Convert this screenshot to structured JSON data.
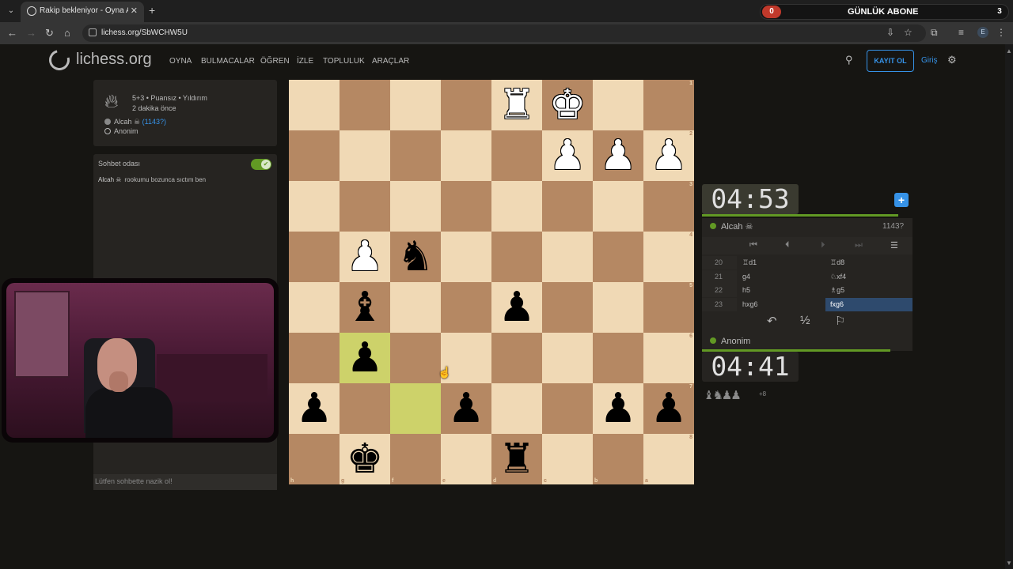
{
  "browser": {
    "tab_title": "Rakip bekleniyor - Oyna Alcah",
    "url": "lichess.org/SbWCHW5U",
    "sub_banner": {
      "left_count": "0",
      "title": "GÜNLÜK ABONE",
      "right_count": "3"
    }
  },
  "header": {
    "logo": "lichess.org",
    "nav": [
      "OYNA",
      "BULMACALAR",
      "ÖĞREN",
      "İZLE",
      "TOPLULUK",
      "ARAÇLAR"
    ],
    "signup": "KAYIT OL",
    "login": "Giriş"
  },
  "game_info": {
    "type": "5+3 • Puansız • Yıldırım",
    "time": "2 dakika önce",
    "player1_name": "Alcah ☠",
    "player1_rating": "(1143?)",
    "player2_name": "Anonim"
  },
  "chat": {
    "title": "Sohbet odası",
    "msg_user": "Alcah ☠",
    "msg_text": "rookumu bozunca sıctım ben",
    "placeholder": "Lütfen sohbette nazik ol!"
  },
  "board": {
    "ranks": [
      "1",
      "2",
      "3",
      "4",
      "5",
      "6",
      "7",
      "8"
    ],
    "files": [
      "h",
      "g",
      "f",
      "e",
      "d",
      "c",
      "b",
      "a"
    ],
    "rows": [
      [
        "",
        "",
        "",
        "",
        "wR",
        "wK",
        "",
        ""
      ],
      [
        "",
        "",
        "",
        "",
        "",
        "wP",
        "wP",
        "wP"
      ],
      [
        "",
        "",
        "",
        "",
        "",
        "",
        "",
        ""
      ],
      [
        "",
        "wP",
        "bN",
        "",
        "",
        "",
        "",
        ""
      ],
      [
        "",
        "bB",
        "",
        "",
        "bP",
        "",
        "",
        ""
      ],
      [
        "",
        "bP",
        "",
        "",
        "",
        "",
        "",
        ""
      ],
      [
        "bP",
        "",
        "",
        "bP",
        "",
        "",
        "bP",
        "bP"
      ],
      [
        "",
        "bK",
        "",
        "",
        "bR",
        "",
        "",
        ""
      ]
    ],
    "last_move": [
      "5,1",
      "6,2"
    ]
  },
  "clocks": {
    "top": {
      "min": "04",
      "sec": "53",
      "player": "Alcah ☠",
      "rating": "1143?"
    },
    "bottom": {
      "min": "04",
      "sec": "41",
      "player": "Anonim"
    }
  },
  "moves": [
    {
      "n": "20",
      "w": "♖d1",
      "b": "♖d8"
    },
    {
      "n": "21",
      "w": "g4",
      "b": "♘xf4"
    },
    {
      "n": "22",
      "w": "h5",
      "b": "♗g5"
    },
    {
      "n": "23",
      "w": "hxg6",
      "b": "fxg6"
    }
  ],
  "captured": {
    "pieces": "♝♞♟♟",
    "diff": "+8"
  }
}
